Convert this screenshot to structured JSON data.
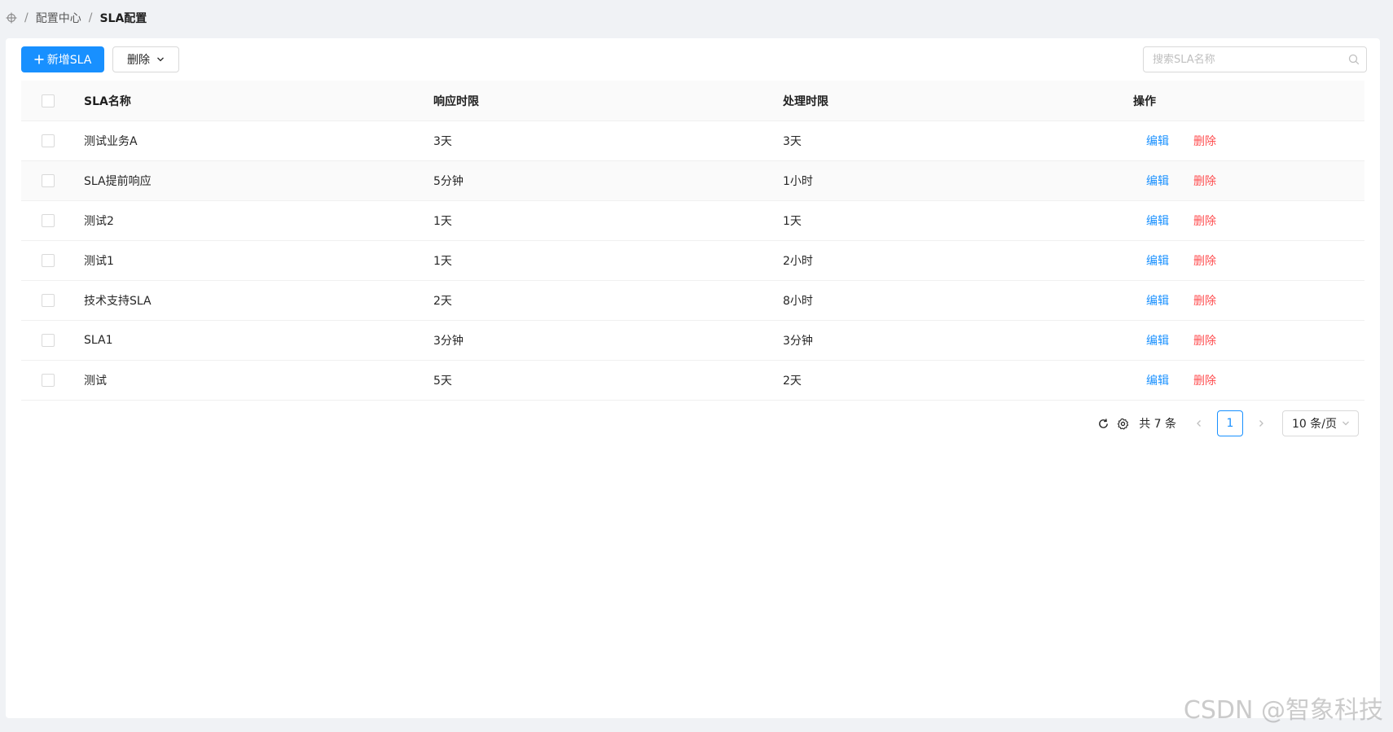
{
  "breadcrumb": {
    "icon": "crosshair-icon",
    "items": [
      "配置中心",
      "SLA配置"
    ],
    "separator": "/"
  },
  "toolbar": {
    "add_label": "新增SLA",
    "delete_label": "删除",
    "search_placeholder": "搜索SLA名称"
  },
  "table": {
    "columns": [
      "SLA名称",
      "响应时限",
      "处理时限",
      "操作"
    ],
    "rows": [
      {
        "name": "测试业务A",
        "response": "3天",
        "process": "3天"
      },
      {
        "name": "SLA提前响应",
        "response": "5分钟",
        "process": "1小时"
      },
      {
        "name": "测试2",
        "response": "1天",
        "process": "1天"
      },
      {
        "name": "测试1",
        "response": "1天",
        "process": "2小时"
      },
      {
        "name": "技术支持SLA",
        "response": "2天",
        "process": "8小时"
      },
      {
        "name": "SLA1",
        "response": "3分钟",
        "process": "3分钟"
      },
      {
        "name": "测试",
        "response": "5天",
        "process": "2天"
      }
    ],
    "actions": {
      "edit": "编辑",
      "delete": "删除"
    }
  },
  "pagination": {
    "total_label": "共 7 条",
    "current_page": "1",
    "page_size": "10 条/页"
  },
  "watermark": "CSDN @智象科技",
  "colors": {
    "primary": "#1890ff",
    "danger": "#ff4d4f"
  }
}
